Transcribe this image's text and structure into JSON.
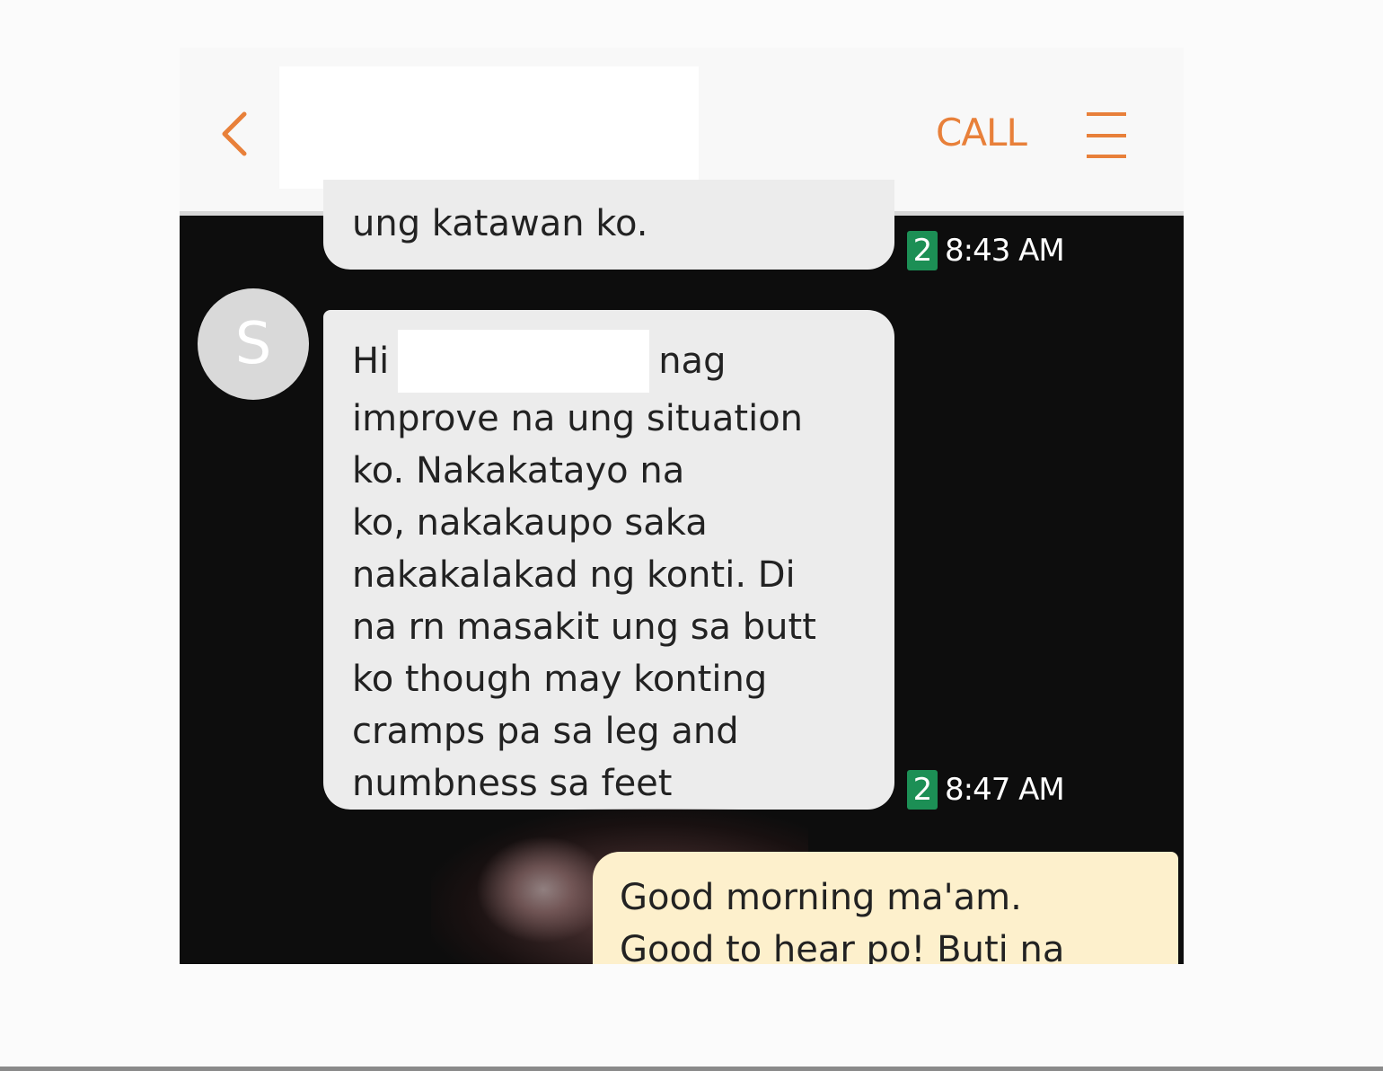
{
  "header": {
    "back_icon": "chevron-left-icon",
    "call_label": "CALL",
    "menu_icon": "hamburger-menu-icon",
    "accent_color": "#e8803a"
  },
  "messages": [
    {
      "lines": [
        "ung katawan ko."
      ],
      "sim_badge": "2",
      "time": "8:43 AM"
    },
    {
      "avatar_initial": "S",
      "first_line_start": "Hi",
      "first_line_end": "nag",
      "lines": [
        "improve na ung situation",
        "ko. Nakakatayo na",
        "ko, nakakaupo saka",
        "nakakalakad ng konti. Di",
        "na rn masakit ung sa butt",
        "ko though may konting",
        "cramps pa sa leg and",
        "numbness sa feet"
      ],
      "sim_badge": "2",
      "time": "8:47 AM"
    },
    {
      "lines": [
        "Good morning ma'am.",
        "Good to hear po! Buti na"
      ]
    }
  ]
}
